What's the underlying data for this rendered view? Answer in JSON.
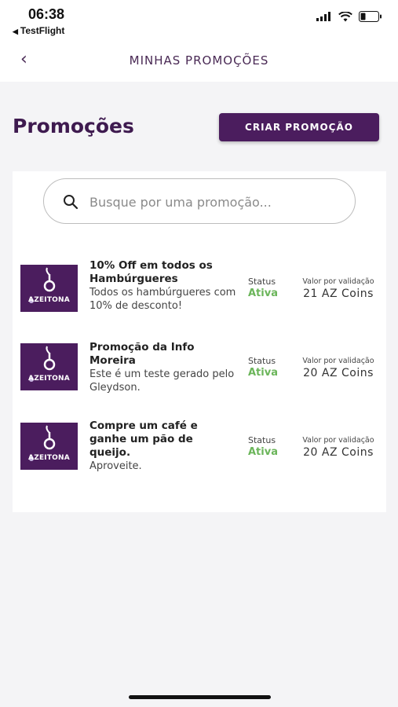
{
  "status_bar": {
    "time": "06:38",
    "back_app": "TestFlight"
  },
  "nav": {
    "title": "MINHAS PROMOÇÕES"
  },
  "header": {
    "title": "Promoções",
    "create_button": "CRIAR PROMOÇÃO"
  },
  "search": {
    "placeholder": "Busque por uma promoção..."
  },
  "labels": {
    "status": "Status",
    "value": "Valor por validação"
  },
  "brand": {
    "logo_text": "AZEITONA",
    "color": "#4b1d5e"
  },
  "promotions": [
    {
      "title": "10% Off em todos os Hambúrgueres",
      "description": "Todos os hambúrgueres com 10% de desconto!",
      "status": "Ativa",
      "value": "21 AZ Coins"
    },
    {
      "title": "Promoção da Info Moreira",
      "description": "Este é um teste gerado pelo Gleydson.",
      "status": "Ativa",
      "value": "20 AZ Coins"
    },
    {
      "title": "Compre um café e ganhe um pão de queijo.",
      "description": "Aproveite.",
      "status": "Ativa",
      "value": "20 AZ Coins"
    }
  ],
  "colors": {
    "accent": "#4b1d5e",
    "active_status": "#6bb55a"
  }
}
